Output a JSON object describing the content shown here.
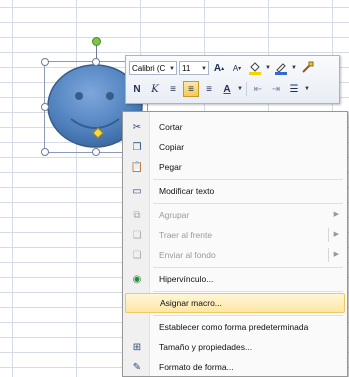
{
  "mini_toolbar": {
    "font_name": "Calibri (C",
    "font_size": "11",
    "grow_font": "A",
    "shrink_font": "A",
    "bold": "N",
    "italic": "K",
    "font_color_letter": "A",
    "colors": {
      "highlight": "#f5d400",
      "line": "#2f6bd0",
      "font": "#d01c1c"
    }
  },
  "context_menu": {
    "items": [
      {
        "label": "Cortar",
        "icon": "scissors-icon"
      },
      {
        "label": "Copiar",
        "icon": "copy-icon"
      },
      {
        "label": "Pegar",
        "icon": "paste-icon"
      },
      {
        "label": "Modificar texto",
        "icon": "edit-text-icon"
      },
      {
        "label": "Agrupar",
        "icon": "group-icon",
        "disabled": true,
        "submenu": true
      },
      {
        "label": "Traer al frente",
        "icon": "bring-front-icon",
        "disabled": true,
        "submenu": true
      },
      {
        "label": "Enviar al fondo",
        "icon": "send-back-icon",
        "disabled": true,
        "submenu": true
      },
      {
        "label": "Hipervínculo...",
        "icon": "hyperlink-icon"
      },
      {
        "label": "Asignar macro...",
        "highlighted": true
      },
      {
        "label": "Establecer como forma predeterminada"
      },
      {
        "label": "Tamaño y propiedades...",
        "icon": "size-properties-icon"
      },
      {
        "label": "Formato de forma...",
        "icon": "format-shape-icon"
      }
    ]
  },
  "shape": {
    "type": "smiley-face",
    "fill": "#4f81bd",
    "outline": "#385d8a"
  }
}
